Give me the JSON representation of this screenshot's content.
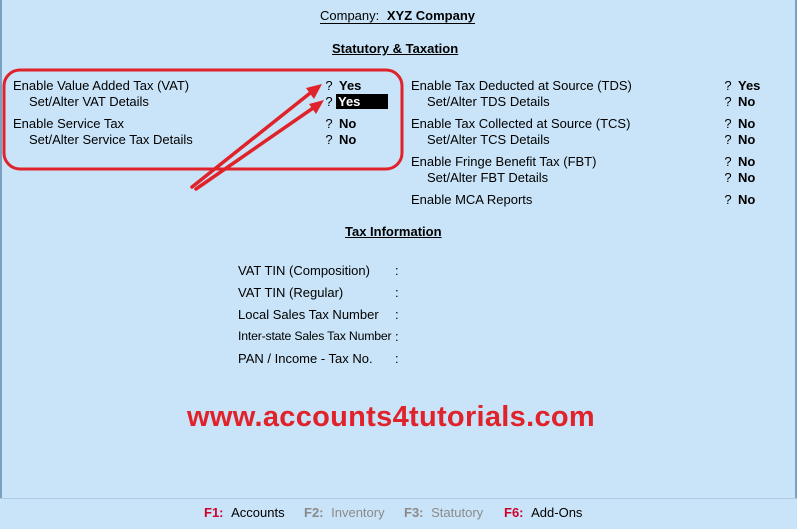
{
  "company": {
    "label": "Company:",
    "name": "XYZ Company"
  },
  "section_title": "Statutory & Taxation",
  "left_options": [
    {
      "label": "Enable Value Added Tax (VAT)",
      "q": "?",
      "value": "Yes"
    },
    {
      "label": "Set/Alter VAT Details",
      "q": "?",
      "value": "Yes"
    },
    {
      "label": "Enable Service Tax",
      "q": "?",
      "value": "No"
    },
    {
      "label": "Set/Alter Service Tax Details",
      "q": "?",
      "value": "No"
    }
  ],
  "right_options": [
    {
      "label": "Enable Tax Deducted at Source (TDS)",
      "q": "?",
      "value": "Yes"
    },
    {
      "label": "Set/Alter TDS Details",
      "q": "?",
      "value": "No"
    },
    {
      "label": "Enable Tax Collected at Source (TCS)",
      "q": "?",
      "value": "No"
    },
    {
      "label": "Set/Alter TCS Details",
      "q": "?",
      "value": "No"
    },
    {
      "label": "Enable Fringe Benefit Tax (FBT)",
      "q": "?",
      "value": "No"
    },
    {
      "label": "Set/Alter FBT Details",
      "q": "?",
      "value": "No"
    },
    {
      "label": "Enable MCA Reports",
      "q": "?",
      "value": "No"
    }
  ],
  "tax_info": {
    "title": "Tax Information",
    "fields": [
      {
        "label": "VAT TIN (Composition)",
        "sep": ":"
      },
      {
        "label": "VAT TIN (Regular)",
        "sep": ":"
      },
      {
        "label": "Local Sales Tax Number",
        "sep": ":"
      },
      {
        "label": "Inter-state Sales Tax Number",
        "sep": ":"
      },
      {
        "label": "PAN / Income - Tax No.",
        "sep": ":"
      }
    ]
  },
  "watermark": "www.accounts4tutorials.com",
  "footer": [
    {
      "key": "F1:",
      "label": "Accounts",
      "enabled": true
    },
    {
      "key": "F2:",
      "label": "Inventory",
      "enabled": false
    },
    {
      "key": "F3:",
      "label": "Statutory",
      "enabled": false
    },
    {
      "key": "F6:",
      "label": "Add-Ons",
      "enabled": true
    }
  ],
  "colors": {
    "background": "#c9e4f8",
    "annotation": "#e0222a",
    "function_key": "#d0002a"
  }
}
